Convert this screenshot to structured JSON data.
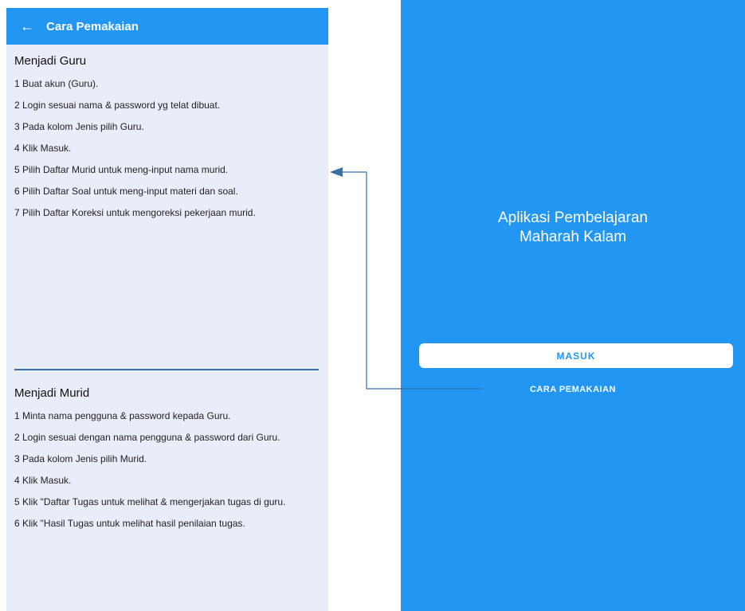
{
  "left_screen": {
    "appbar": {
      "back_icon": "arrow-left-icon",
      "back_glyph": "←",
      "title": "Cara Pemakaian"
    },
    "guru": {
      "title": "Menjadi Guru",
      "steps": [
        {
          "num": "1",
          "text": "Buat akun (Guru)."
        },
        {
          "num": "2",
          "text": "Login sesuai nama & password yg telat dibuat."
        },
        {
          "num": "3",
          "text": "Pada kolom Jenis pilih Guru."
        },
        {
          "num": "4",
          "text": "Klik Masuk."
        },
        {
          "num": "5",
          "text": "Pilih Daftar Murid untuk meng-input nama murid."
        },
        {
          "num": "6",
          "text": "Pilih Daftar Soal untuk meng-input materi dan soal."
        },
        {
          "num": "7",
          "text": "Pilih Daftar Koreksi untuk mengoreksi pekerjaan murid."
        }
      ]
    },
    "murid": {
      "title": "Menjadi Murid",
      "steps": [
        {
          "num": "1",
          "text": "Minta nama pengguna & password kepada Guru."
        },
        {
          "num": "2",
          "text": "Login sesuai dengan nama pengguna & password dari Guru."
        },
        {
          "num": "3",
          "text": "Pada kolom Jenis pilih Murid."
        },
        {
          "num": "4",
          "text": "Klik Masuk."
        },
        {
          "num": "5",
          "text": "Klik \"Daftar Tugas untuk melihat & mengerjakan tugas di guru."
        },
        {
          "num": "6",
          "text": "Klik \"Hasil Tugas untuk melihat hasil penilaian tugas."
        }
      ]
    }
  },
  "right_screen": {
    "app_name_line1": "Aplikasi Pembelajaran",
    "app_name_line2": "Maharah Kalam",
    "masuk_label": "MASUK",
    "cara_label": "CARA PEMAKAIAN"
  },
  "colors": {
    "primary": "#2196f3",
    "left_background": "#e9ecf9",
    "divider": "#3d6f9e"
  }
}
